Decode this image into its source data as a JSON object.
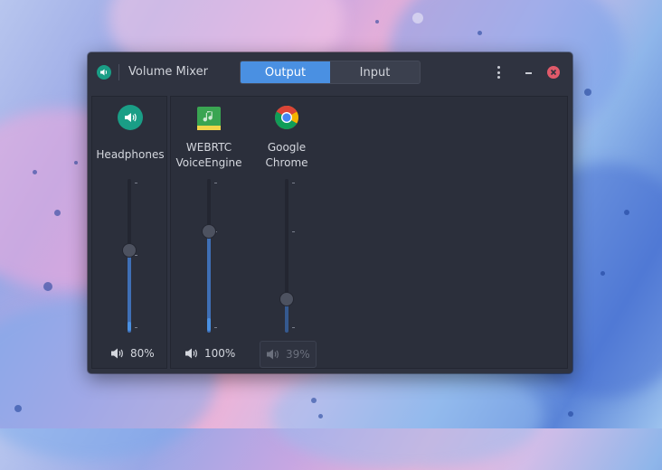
{
  "window": {
    "title": "Volume Mixer",
    "tabs": [
      {
        "label": "Output",
        "active": true
      },
      {
        "label": "Input",
        "active": false
      }
    ],
    "accent_color": "#4a90e2",
    "close_color": "#e05a6a"
  },
  "channels": [
    {
      "name": "Headphones",
      "icon": "speaker-icon",
      "volume_label": "80%",
      "volume": 0.8,
      "muted": false
    },
    {
      "name_line1": "WEBRTC",
      "name_line2": "VoiceEngine",
      "icon": "music-app-icon",
      "volume_label": "100%",
      "volume": 1.0,
      "muted": false
    },
    {
      "name_line1": "Google",
      "name_line2": "Chrome",
      "icon": "chrome-icon",
      "volume_label": "39%",
      "volume": 0.39,
      "muted": true
    }
  ]
}
